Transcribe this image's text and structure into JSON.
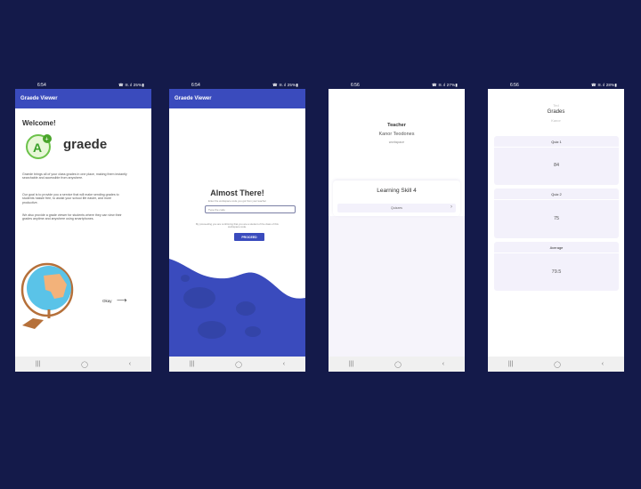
{
  "phone1": {
    "time": "6:54",
    "status_right": "☎ ≋.ıl 25%▮",
    "app_title": "Graede Viewer",
    "welcome": "Welcome!",
    "brand": "graede",
    "para1": "Graede brings all of your class grades in one place, making them instantly searchable and accessible from anywhere.",
    "para2": "Our goal is to provide you a service that will make sending grades to students hassle free, to assist your school life easier, and more productive.",
    "para3": "We also provide a grade viewer for students where they can view their grades anytime and anywhere using smartphones.",
    "okay": "Okay"
  },
  "phone2": {
    "time": "6:54",
    "status_right": "☎ ≋.ıl 25%▮",
    "app_title": "Graede Viewer",
    "heading": "Almost There!",
    "subtitle": "Enter the workspace code you got from your teacher",
    "placeholder": "Type the code",
    "consent": "By proceeding you are confirming that you are a student of the class of this workspace code.",
    "proceed": "PROCEED"
  },
  "phone3": {
    "time": "6:56",
    "status_right": "☎ ≋.ıl 27%▮",
    "teacher_label": "Teacher",
    "teacher_name": "Kanor Teodones",
    "workspace": "workspace",
    "skill_title": "Learning Skill 4",
    "quizzes": "Quizzes"
  },
  "phone4": {
    "time": "6:56",
    "status_right": "☎ ≋.ıl 28%▮",
    "top_label": "Ted",
    "grades": "Grades",
    "sub_label": "Kanor",
    "cards": [
      {
        "header": "Quiz 1",
        "value": "84"
      },
      {
        "header": "Quiz 2",
        "value": "75"
      },
      {
        "header": "Average",
        "value": "79.5"
      }
    ]
  },
  "nav": {
    "recent": "|||",
    "home": "◯",
    "back": "‹"
  },
  "colors": {
    "background": "#141a4a",
    "primary": "#3a4bbd",
    "card": "#f3f1fb"
  }
}
